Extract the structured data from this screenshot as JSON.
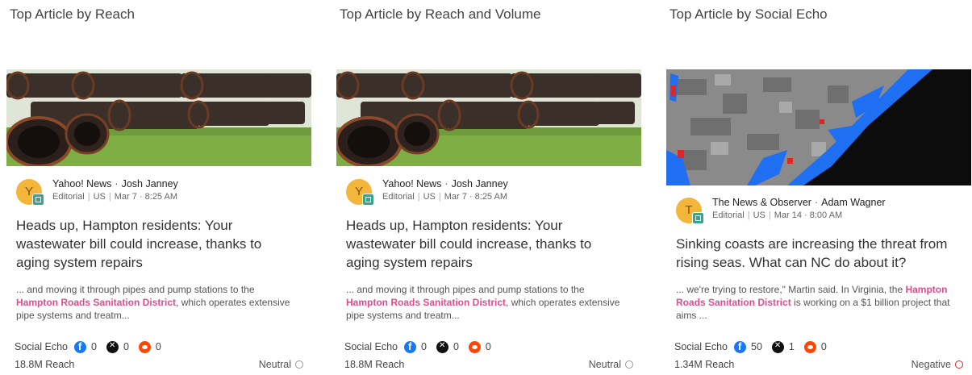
{
  "columns": [
    {
      "title": "Top Article by Reach",
      "image": "pipes-photo",
      "avatar_letter": "Y",
      "source": "Yahoo! News",
      "author": "Josh Janney",
      "meta": [
        "Editorial",
        "US",
        "Mar 7 · 8:25 AM"
      ],
      "headline": "Heads up, Hampton residents: Your wastewater bill could increase, thanks to aging system repairs",
      "snippet_before": "... and moving it through pipes and pump stations to the ",
      "snippet_highlight": "Hampton Roads Sanitation District",
      "snippet_after": ", which operates extensive pipe systems and treatm...",
      "echo_label": "Social Echo",
      "facebook": "0",
      "x": "0",
      "reddit": "0",
      "reach": "18.8M Reach",
      "sentiment": "Neutral"
    },
    {
      "title": "Top Article by Reach and Volume",
      "image": "pipes-photo",
      "avatar_letter": "Y",
      "source": "Yahoo! News",
      "author": "Josh Janney",
      "meta": [
        "Editorial",
        "US",
        "Mar 7 · 8:25 AM"
      ],
      "headline": "Heads up, Hampton residents: Your wastewater bill could increase, thanks to aging system repairs",
      "snippet_before": "... and moving it through pipes and pump stations to the ",
      "snippet_highlight": "Hampton Roads Sanitation District",
      "snippet_after": ", which operates extensive pipe systems and treatm...",
      "echo_label": "Social Echo",
      "facebook": "0",
      "x": "0",
      "reddit": "0",
      "reach": "18.8M Reach",
      "sentiment": "Neutral"
    },
    {
      "title": "Top Article by Social Echo",
      "image": "coast-map",
      "avatar_letter": "T",
      "source": "The News & Observer",
      "author": "Adam Wagner",
      "meta": [
        "Editorial",
        "US",
        "Mar 14 · 8:00 AM"
      ],
      "headline": "Sinking coasts are increasing the threat from rising seas. What can NC do about it?",
      "snippet_before": "... we're trying to restore,\" Martin said. In Virginia, the ",
      "snippet_highlight": "Hampton Roads Sanitation District",
      "snippet_after": " is working on a $1 billion project that aims ...",
      "echo_label": "Social Echo",
      "facebook": "50",
      "x": "1",
      "reddit": "0",
      "reach": "1.34M Reach",
      "sentiment": "Negative"
    }
  ],
  "colors": {
    "highlight": "#e34b8a",
    "avatar": "#f3b53a",
    "negative": "#e0202e",
    "neutral": "#999999"
  }
}
